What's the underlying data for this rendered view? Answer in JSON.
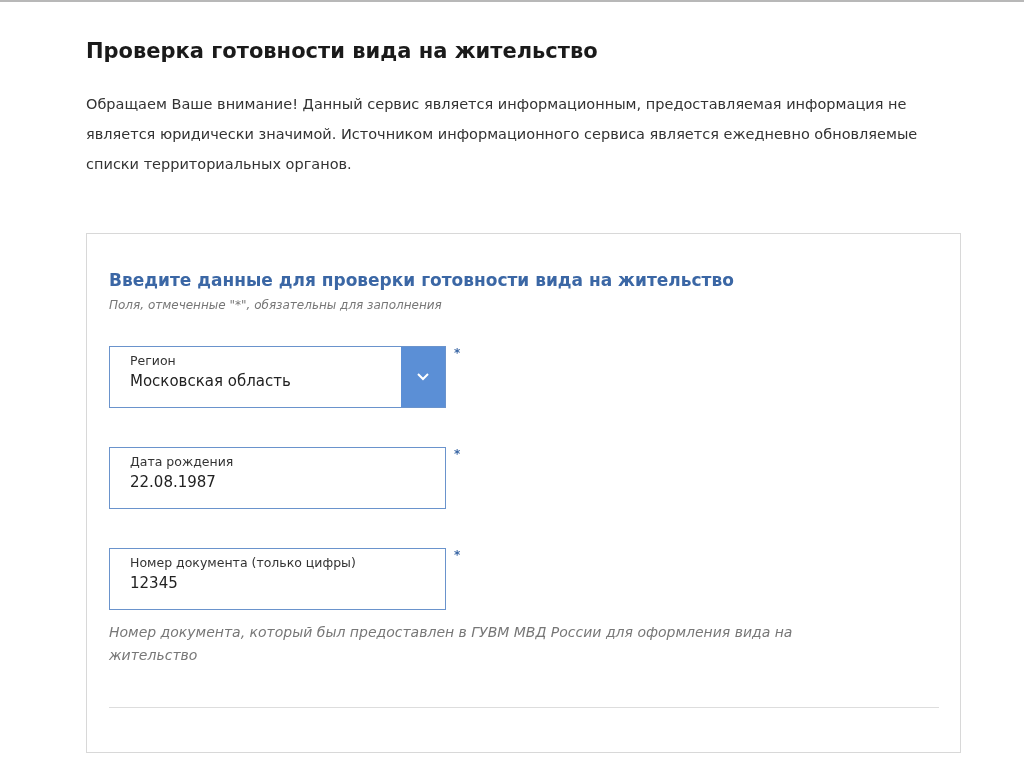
{
  "title": "Проверка готовности вида на жительство",
  "notice": "Обращаем Ваше внимание! Данный сервис является информационным, предоставляемая информация не является юридически значимой. Источником информационного сервиса является ежедневно обновляемые списки территориальных органов.",
  "form": {
    "heading": "Введите данные для проверки готовности вида на жительство",
    "required_note": "Поля, отмеченные \"*\", обязательны для заполнения",
    "fields": [
      {
        "kind": "select",
        "label": "Регион",
        "value": "Московская область",
        "required_mark": "*"
      },
      {
        "kind": "input",
        "label": "Дата рождения",
        "value": "22.08.1987",
        "required_mark": "*"
      },
      {
        "kind": "input",
        "label": "Номер документа (только цифры)",
        "value": "12345",
        "required_mark": "*",
        "hint": "Номер документа, который был предоставлен в ГУВМ МВД России для оформления вида на жительство"
      }
    ]
  }
}
